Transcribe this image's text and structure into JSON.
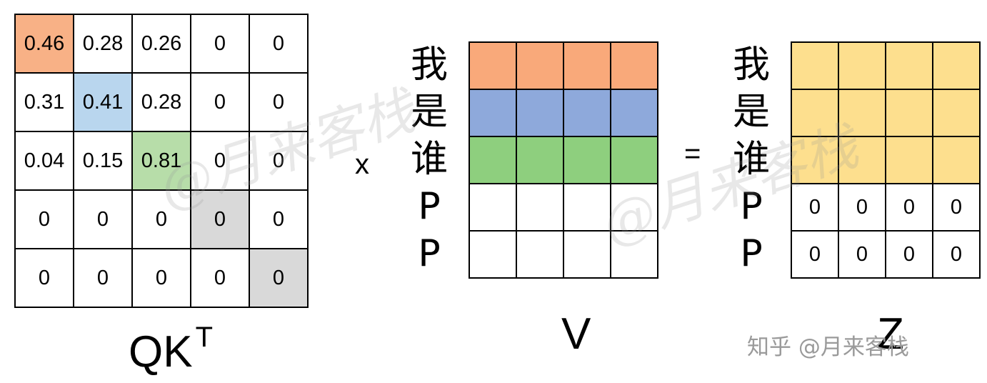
{
  "colors": {
    "orange": "#F8B186",
    "blue": "#B9D6EE",
    "green": "#B7DDA9",
    "gray": "#D9D9D9",
    "v_orange": "#F9A97A",
    "v_blue": "#8EA9DB",
    "v_green": "#8ECF7E",
    "z_yellow": "#FDDF8E",
    "white": "#FFFFFF"
  },
  "qk": {
    "label": "QK",
    "superscript": "T",
    "rows": [
      [
        {
          "v": "0.46",
          "c": "orange"
        },
        {
          "v": "0.28"
        },
        {
          "v": "0.26"
        },
        {
          "v": "0"
        },
        {
          "v": "0"
        }
      ],
      [
        {
          "v": "0.31"
        },
        {
          "v": "0.41",
          "c": "blue"
        },
        {
          "v": "0.28"
        },
        {
          "v": "0"
        },
        {
          "v": "0"
        }
      ],
      [
        {
          "v": "0.04"
        },
        {
          "v": "0.15"
        },
        {
          "v": "0.81",
          "c": "green"
        },
        {
          "v": "0"
        },
        {
          "v": "0"
        }
      ],
      [
        {
          "v": "0"
        },
        {
          "v": "0"
        },
        {
          "v": "0"
        },
        {
          "v": "0",
          "c": "gray"
        },
        {
          "v": "0"
        }
      ],
      [
        {
          "v": "0"
        },
        {
          "v": "0"
        },
        {
          "v": "0"
        },
        {
          "v": "0"
        },
        {
          "v": "0",
          "c": "gray"
        }
      ]
    ]
  },
  "operators": {
    "times": "x",
    "equals": "="
  },
  "row_labels": [
    "我",
    "是",
    "谁",
    "P",
    "P"
  ],
  "v": {
    "label": "V",
    "row_colors": [
      "v_orange",
      "v_blue",
      "v_green",
      "white",
      "white"
    ],
    "cols": 4
  },
  "z": {
    "label": "Z",
    "rows": [
      [
        {
          "v": "",
          "c": "z_yellow"
        },
        {
          "v": "",
          "c": "z_yellow"
        },
        {
          "v": "",
          "c": "z_yellow"
        },
        {
          "v": "",
          "c": "z_yellow"
        }
      ],
      [
        {
          "v": "",
          "c": "z_yellow"
        },
        {
          "v": "",
          "c": "z_yellow"
        },
        {
          "v": "",
          "c": "z_yellow"
        },
        {
          "v": "",
          "c": "z_yellow"
        }
      ],
      [
        {
          "v": "",
          "c": "z_yellow"
        },
        {
          "v": "",
          "c": "z_yellow"
        },
        {
          "v": "",
          "c": "z_yellow"
        },
        {
          "v": "",
          "c": "z_yellow"
        }
      ],
      [
        {
          "v": "0"
        },
        {
          "v": "0"
        },
        {
          "v": "0"
        },
        {
          "v": "0"
        }
      ],
      [
        {
          "v": "0"
        },
        {
          "v": "0"
        },
        {
          "v": "0"
        },
        {
          "v": "0"
        }
      ]
    ]
  },
  "watermark": {
    "diagonal": "@月来客栈",
    "footer": "知乎 @月来客栈"
  }
}
